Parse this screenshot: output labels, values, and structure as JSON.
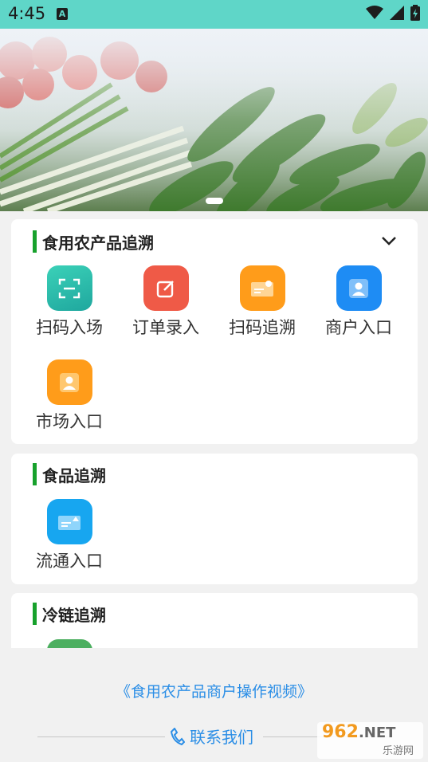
{
  "status_bar": {
    "time": "4:45",
    "notif": "A"
  },
  "sections": [
    {
      "title": "食用农产品追溯",
      "items": [
        {
          "label": "扫码入场",
          "color": "#27bfae"
        },
        {
          "label": "订单录入",
          "color": "#ef5a47"
        },
        {
          "label": "扫码追溯",
          "color": "#ff9c1a"
        },
        {
          "label": "商户入口",
          "color": "#1e8cf4"
        },
        {
          "label": "市场入口",
          "color": "#ff9c1a"
        }
      ]
    },
    {
      "title": "食品追溯",
      "items": [
        {
          "label": "流通入口",
          "color": "#17a6f0"
        }
      ]
    },
    {
      "title": "冷链追溯",
      "items": [
        {
          "label": "",
          "color": "#4caf60"
        }
      ]
    }
  ],
  "footer": {
    "video_link": "《食用农产品商户操作视频》",
    "contact": "联系我们"
  },
  "watermark": {
    "brand": "962",
    "suffix": ".NET",
    "sub": "乐游网"
  }
}
